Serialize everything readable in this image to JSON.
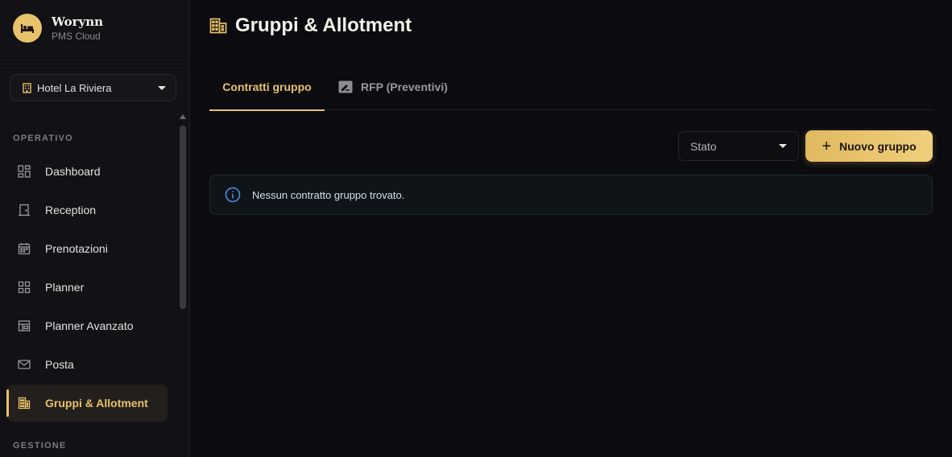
{
  "brand": {
    "name": "Worynn",
    "subtitle": "PMS Cloud"
  },
  "hotel_select": {
    "value": "Hotel La Riviera"
  },
  "sidebar": {
    "section_operativo": "OPERATIVO",
    "section_gestione": "GESTIONE",
    "items": [
      {
        "label": "Dashboard",
        "icon": "dashboard-icon"
      },
      {
        "label": "Reception",
        "icon": "door-icon"
      },
      {
        "label": "Prenotazioni",
        "icon": "calendar-icon"
      },
      {
        "label": "Planner",
        "icon": "grid-icon"
      },
      {
        "label": "Planner Avanzato",
        "icon": "layout-icon"
      },
      {
        "label": "Posta",
        "icon": "mail-icon"
      },
      {
        "label": "Gruppi & Allotment",
        "icon": "building-icon",
        "active": true
      }
    ]
  },
  "page": {
    "title": "Gruppi & Allotment"
  },
  "tabs": [
    {
      "label": "Contratti gruppo",
      "active": true
    },
    {
      "label": "RFP (Preventivi)",
      "icon": "rfp-icon"
    }
  ],
  "filters": {
    "state_placeholder": "Stato"
  },
  "actions": {
    "new_group": "Nuovo gruppo"
  },
  "alert": {
    "message": "Nessun contratto gruppo trovato."
  },
  "colors": {
    "accent": "#e8c26a",
    "background": "#0c0b0f",
    "sidebar": "#121116",
    "info": "#4a8fe0"
  }
}
